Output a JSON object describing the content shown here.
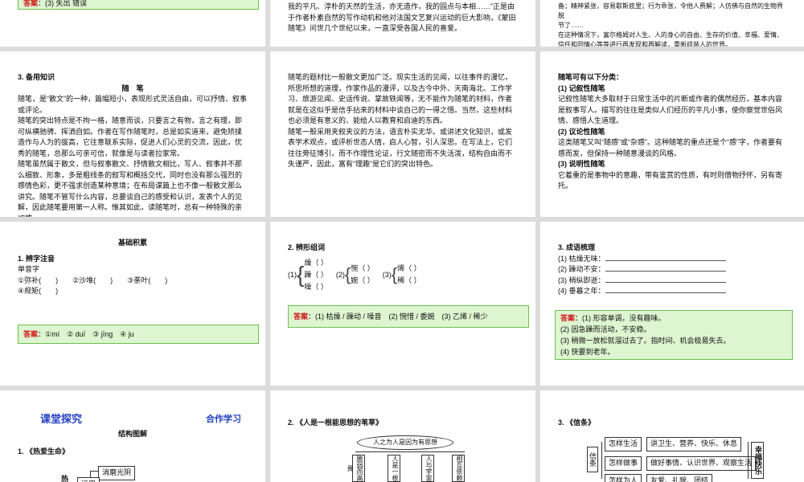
{
  "s1": {
    "answer_label": "答案",
    "answer_text": "：(3) 失出  错误"
  },
  "s2": {
    "lines": [
      "我的平凡、淳朴的天然的生活，亦无造作，我的园点与本相……”正是由",
      "于作者朴素自然的写作动机和他对法国文艺复兴运动的巨大影响，《蒙田",
      "随笔》问世几个世纪以来，一直深受各国人民的喜爱。"
    ]
  },
  "s3": {
    "lines": [
      "备；精神紧张，容易歇斯底里；行为乖张，令他人费解；人仿佛与自然的生物界脱",
      "节了……",
      "在这种情况下，富尔格姆对人生、人的身心的自由、生存的价值、幸福、爱情、",
      "信任和同情心等等进行再发现和再解读，重新组装人的世界。"
    ]
  },
  "s4": {
    "heading": "3. 备用知识",
    "subheading": "随　笔",
    "paragraphs": [
      "随笔，是“散文”的一种，篇幅短小，表现形式灵活自由，可以抒情、叙事或评论。",
      "随笔的突出特点是不拘一格，随意而谈，只要言之有物，言之有理，即可纵横驰骋、挥洒自如。作者在写作随笔时，总是如实道来，避免矫揉造作与人为的拔高，它往意联系实际，促进人们心灵的交流，因此，优秀的随笔，总那么可亲可信，就像是与读者拉家常。",
      "随笔虽然属于散文，但与叙事散文、抒情散文相比，写人、叙事并不那么细致、形象，多是粗线条的叙写和概括交代，同时也没有那么强烈的感情色彩，更不强求创造某种意境；在布局谋篇上也不像一般散文那么讲究。随笔不管写什么内容，总要谈自己的感受和认识，发表个人的见解，因此随笔要用第一人称。惟其如此，读随笔时，总有一种特殊的亲切感。"
    ]
  },
  "s5": {
    "paragraphs": [
      "随笔的题材比一般散文更加广泛。现实生活的见闻，以往事件的漫忆，所思所想的道理，作家作品的漫评，以及古今中外、天南海北、工作学习、旅游见闻、史话传说、掌故轶闻等，无不能作为随笔的材料，作者就是在这似乎是信手拈来的材料中谈自己的一得之悟。当然，这些材料也必须是有意义的、能给人以教育和启迪的东西。",
      "随笔一般采用夹叙夹议的方法，语言朴实无华。或讲述文化知识，或发表学术观点，或评析世态人情，启人心智，引人深思。在写法上，它们往往旁征博引，而不作理性论证，行文随密而不失活泼，结构自由而不失谨严，因此，富有“理趣”是它们的突出特色。"
    ]
  },
  "s6": {
    "heading": "随笔可有以下分类：",
    "items": [
      {
        "title": "(1) 记叙性随笔",
        "text": "记叙性随笔大多取材于日常生活中的片断或作者的偶然经历，基本内容是叙事写人。描写的往往是类似人们经历的平凡小事，使你察觉世俗风情、感悟人生道理。"
      },
      {
        "title": "(2) 议论性随笔",
        "text": "这类随笔又叫“随感”或“杂感”。这种随笔的重点还是个“感”字，作者要有感而发，但保持一种随意漫谈的风格。"
      },
      {
        "title": "(3) 说明性随笔",
        "text": "它着重的是事物中的意趣，带有鉴赏的性质，有时则借物抒怀，另有寄托。"
      }
    ]
  },
  "s7": {
    "heading": "基础积累",
    "sub": "1. 辨字注音",
    "label": "单音字",
    "row1": "①弥补(　　)　　②沙堆(　　)　　③荼叶(　　)",
    "row2": "④规矩(　　)",
    "answer_label": "答案",
    "answer_text": "：①mí　② duī　③ jīnɡ　④ ju"
  },
  "s8": {
    "heading": "2. 辨形组词",
    "g1": {
      "num": "(1)",
      "chars": [
        "燥（ ）",
        "躁（ ）",
        "噪（ ）"
      ]
    },
    "g2": {
      "num": "(2)",
      "chars": [
        "惋（ ）",
        "婉（ ）"
      ]
    },
    "g3": {
      "num": "(3)",
      "chars": [
        "烯（ ）",
        "稀（ ）"
      ]
    },
    "answer_label": "答案",
    "answer_text": "：(1) 枯燥 / 躁动 / 噪音　(2) 惋惜 / 委婉　(3) 乙烯 / 稀少"
  },
  "s9": {
    "heading": "3. 成语梳理",
    "items": [
      "(1) 枯燥无味：",
      "(2) 躁动不安：",
      "(3) 稍纵即逝：",
      "(4) 垂暮之年："
    ],
    "answer_label": "答案",
    "answers": [
      "：(1) 形容单调，没有趣味。",
      "(2) 因急躁而活动，不安稳。",
      "(3) 稍微一放松就溜过去了。指时间、机会极易失去。",
      "(4) 快要到老年。"
    ]
  },
  "s10": {
    "title": "课堂探究",
    "tag": "合作学习",
    "sub": "结构图解",
    "item": "1. 《热爱生命》",
    "node1": "消磨光阴",
    "node2": "热",
    "node3": "运用"
  },
  "s11": {
    "heading": "2. 《人是一根能思想的苇草》",
    "top": "人之为人是因为有思想",
    "arrow1": "脆弱而高贵",
    "arrow2": "人是一根",
    "arrow3": "人与宇宙",
    "arrow4": "相互依赖"
  },
  "s12": {
    "heading": "3. 《信条》",
    "left": "信条",
    "rows": [
      {
        "key": "怎样生活",
        "val": "讲卫生、营养、快乐、休息"
      },
      {
        "key": "怎样做事",
        "val": "做好事情、认识世界、观察生活"
      },
      {
        "key": "怎样为人",
        "val": "友爱、礼貌、团结"
      }
    ],
    "right": "幸福快乐"
  }
}
